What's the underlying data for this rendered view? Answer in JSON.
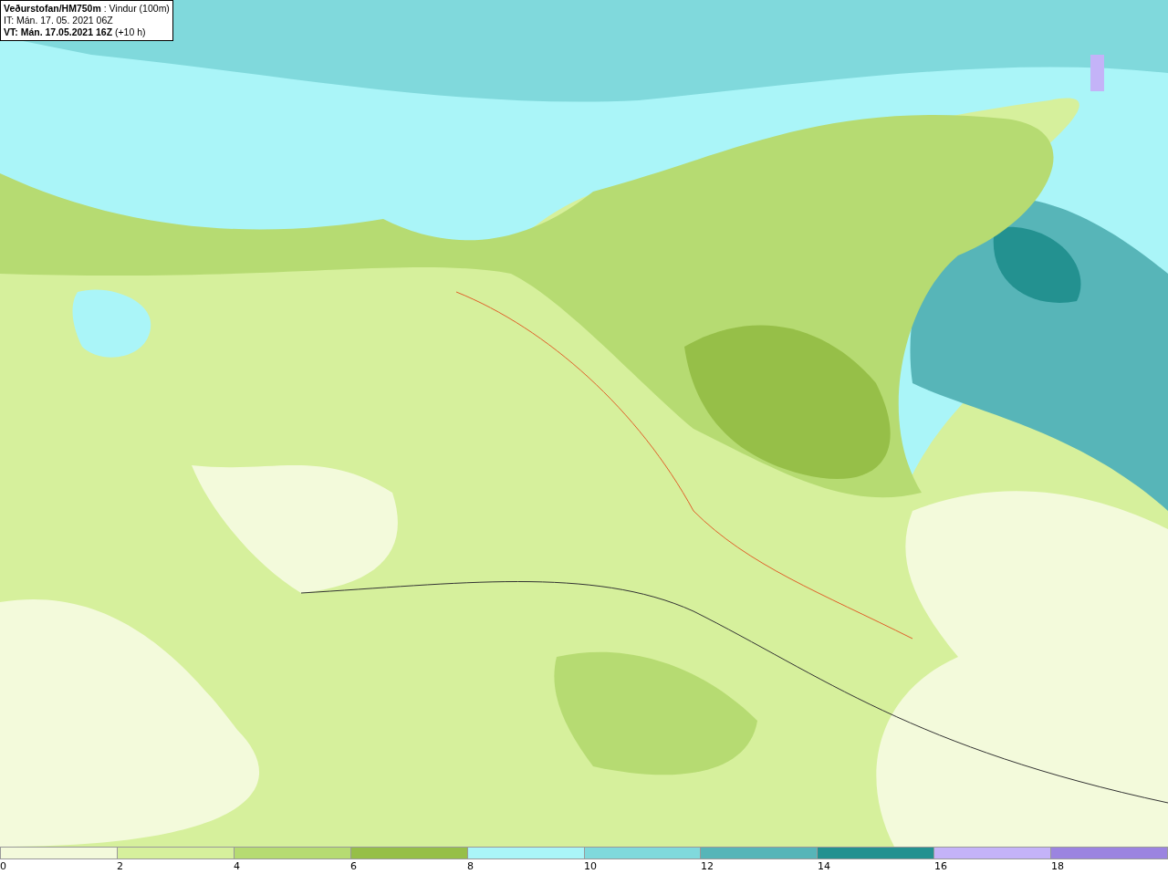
{
  "title_box": {
    "lines": [
      "**Veðurstofan/HM750m** : Vindur (100m)",
      "IT: Mán. 17. 05. 2021 06Z",
      "**VT: Mán. 17.05.2021 16Z** (+10 h)"
    ]
  },
  "legend": [
    {
      "label": "0",
      "color": "#f3fadb"
    },
    {
      "label": "2",
      "color": "#d6f09c"
    },
    {
      "label": "4",
      "color": "#b6db72"
    },
    {
      "label": "6",
      "color": "#96bf48"
    },
    {
      "label": "8",
      "color": "#aaf5f8"
    },
    {
      "label": "10",
      "color": "#80d9dc"
    },
    {
      "label": "12",
      "color": "#57b5b8"
    },
    {
      "label": "14",
      "color": "#239190"
    },
    {
      "label": "16",
      "color": "#c4b3f8"
    },
    {
      "label": "18",
      "color": "#9b84e0"
    }
  ]
}
